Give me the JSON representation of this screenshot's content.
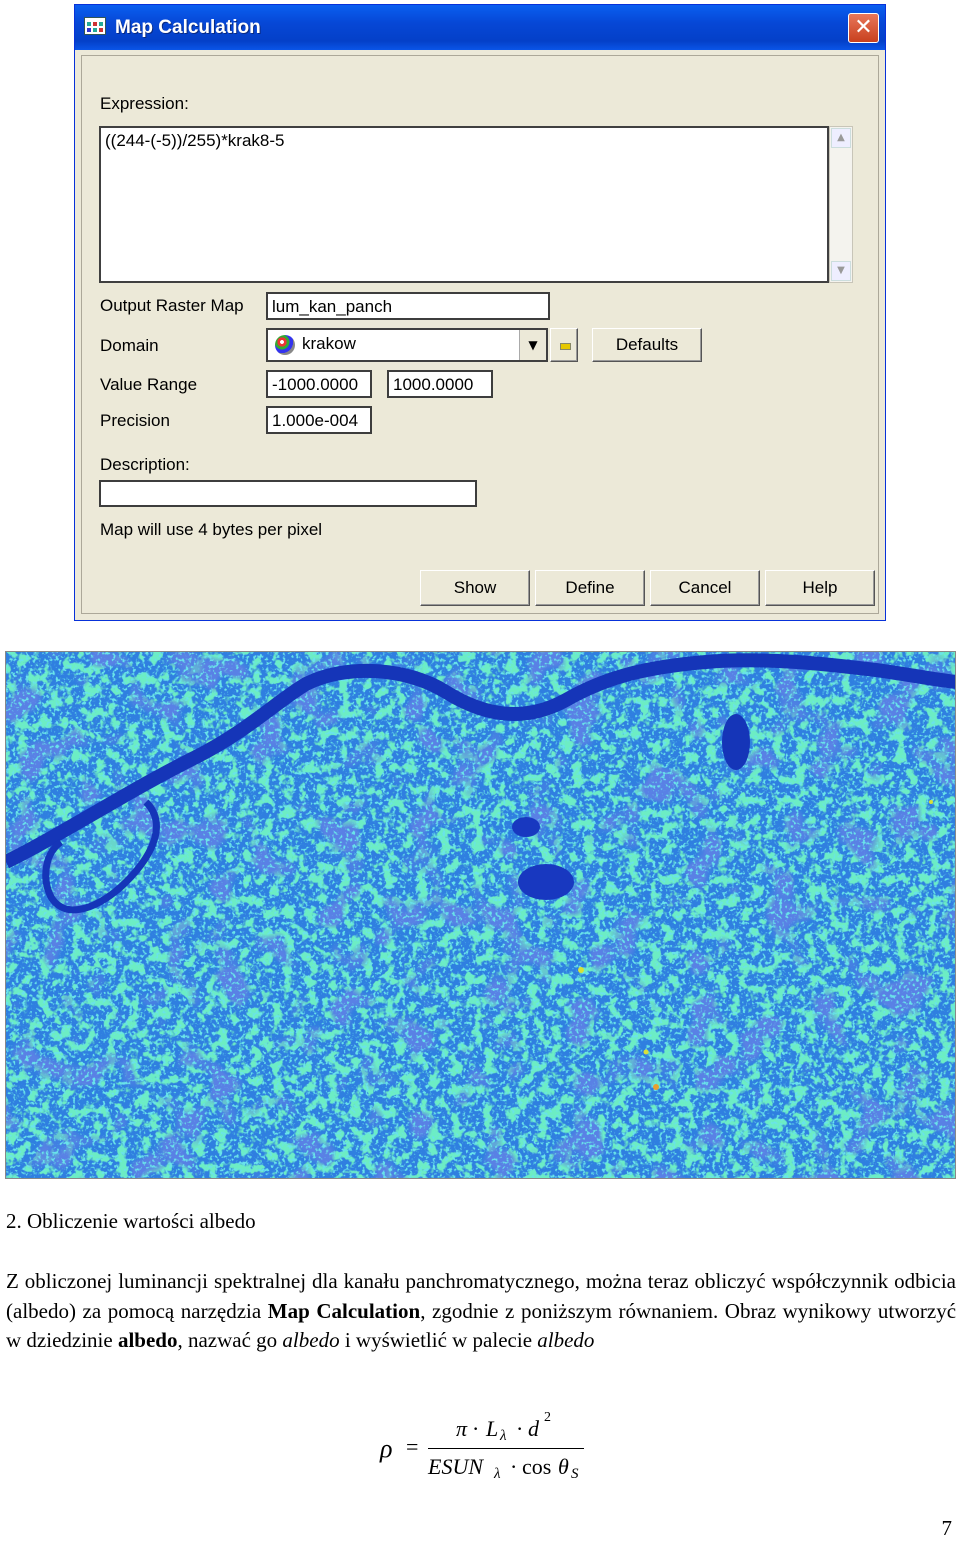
{
  "dialog": {
    "title": "Map Calculation",
    "close_symbol": "✕",
    "expression_label": "Expression:",
    "expression_value": "((244-(-5))/255)*krak8-5",
    "output_label": "Output Raster Map",
    "output_value": "lum_kan_panch",
    "domain_label": "Domain",
    "domain_value": "krakow",
    "defaults_label": "Defaults",
    "value_range_label": "Value Range",
    "value_min": "-1000.0000",
    "value_max": "1000.0000",
    "precision_label": "Precision",
    "precision_value": "1.000e-004",
    "description_label": "Description:",
    "description_value": "",
    "bytes_note": "Map will use 4 bytes per pixel",
    "buttons": {
      "show": "Show",
      "define": "Define",
      "cancel": "Cancel",
      "help": "Help"
    }
  },
  "doc": {
    "heading": "2.   Obliczenie wartości albedo",
    "para": {
      "p1": "Z obliczonej luminancji spektralnej dla kanału panchromatycznego, można teraz obliczyć współczynnik odbicia (albedo) za pomocą narzędzia ",
      "b1": "Map Calculation",
      "p2": ", zgodnie z poniższym równaniem. Obraz wynikowy utworzyć w dziedzinie ",
      "b2": "albedo",
      "p3": ", nazwać go ",
      "i1": "albedo",
      "p4": " i wyświetlić w palecie ",
      "i2": "albedo"
    },
    "formula": {
      "rho": "ρ",
      "eq": "=",
      "pi": "π",
      "dot": "·",
      "L": "L",
      "lambda": "λ",
      "d": "d",
      "exp2": "2",
      "esun": "ESUN",
      "cos": "cos",
      "theta": "θ",
      "s": "S"
    },
    "page_number": "7"
  },
  "map_colors": {
    "background": "#2f7fe0",
    "green": "#25d98a",
    "cyan": "#24c4d0",
    "dark_blue": "#1838c0",
    "yellow": "#d8e038"
  }
}
